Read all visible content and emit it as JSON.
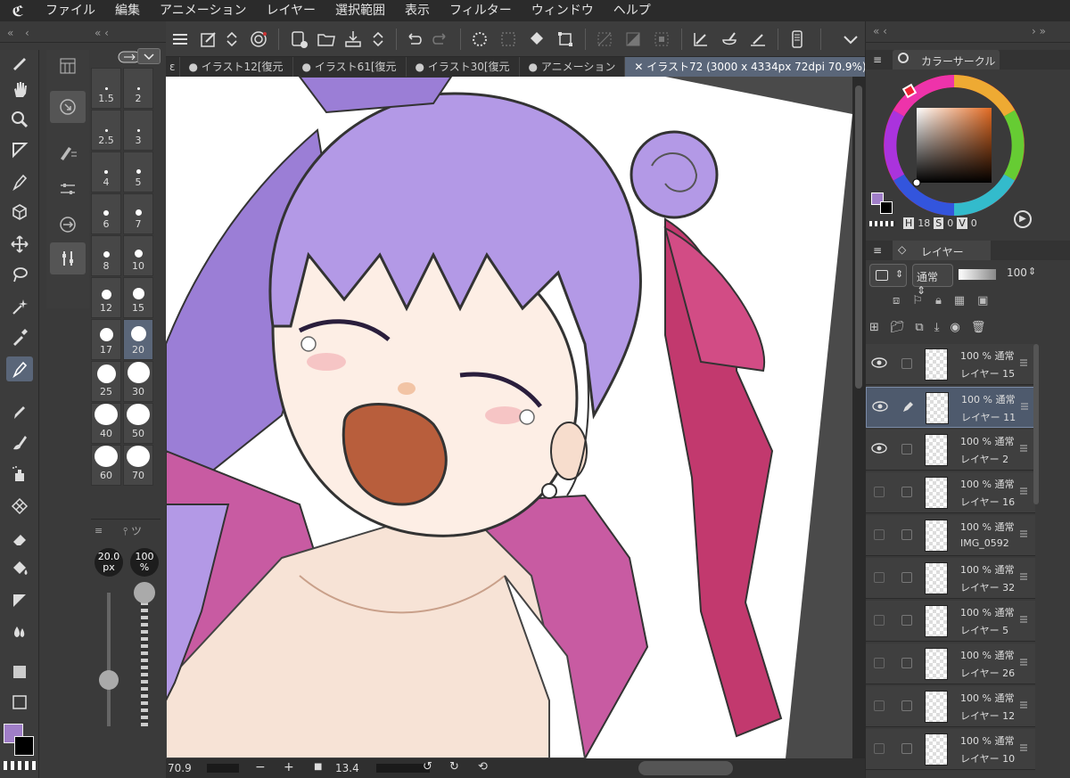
{
  "menu": {
    "items": [
      "ファイル",
      "編集",
      "アニメーション",
      "レイヤー",
      "選択範囲",
      "表示",
      "フィルター",
      "ウィンドウ",
      "ヘルプ"
    ]
  },
  "tabs": [
    {
      "label": "イラスト12[復元"
    },
    {
      "label": "イラスト61[復元"
    },
    {
      "label": "イラスト30[復元"
    },
    {
      "label": "アニメーション"
    },
    {
      "label": "イラスト72 (3000 x 4334px 72dpi 70.9%)",
      "active": true
    }
  ],
  "brush_sizes": [
    "1.5",
    "2",
    "2.5",
    "3",
    "4",
    "5",
    "6",
    "7",
    "8",
    "10",
    "12",
    "15",
    "17",
    "20",
    "25",
    "30",
    "40",
    "50",
    "60",
    "70"
  ],
  "brush_selected": "20",
  "slider_panel": {
    "tab_label": "ツ",
    "size_value": "20.0",
    "size_unit": "px",
    "opacity_value": "100",
    "opacity_unit": "%",
    "size_level": 0.35,
    "opacity_level": 1.0
  },
  "status": {
    "zoom": "70.9",
    "angle": "13.4"
  },
  "color_panel": {
    "title": "カラーサークル",
    "h_label": "H",
    "h_value": "18",
    "s_label": "S",
    "s_value": "0",
    "v_label": "V",
    "v_value": "0"
  },
  "layer_panel": {
    "title": "レイヤー",
    "blend_mode": "通常",
    "opacity": "100",
    "layers": [
      {
        "pct": "100 %  通常",
        "name": "レイヤー 15",
        "visible": true,
        "selected": false
      },
      {
        "pct": "100 %  通常",
        "name": "レイヤー 11",
        "visible": true,
        "selected": true
      },
      {
        "pct": "100 %  通常",
        "name": "レイヤー 2",
        "visible": true,
        "selected": false
      },
      {
        "pct": "100 %  通常",
        "name": "レイヤー 16",
        "visible": false,
        "selected": false
      },
      {
        "pct": "100 %  通常",
        "name": "IMG_0592",
        "visible": false,
        "selected": false
      },
      {
        "pct": "100 %  通常",
        "name": "レイヤー 32",
        "visible": false,
        "selected": false
      },
      {
        "pct": "100 %  通常",
        "name": "レイヤー 5",
        "visible": false,
        "selected": false
      },
      {
        "pct": "100 %  通常",
        "name": "レイヤー 26",
        "visible": false,
        "selected": false
      },
      {
        "pct": "100 %  通常",
        "name": "レイヤー 12",
        "visible": false,
        "selected": false
      },
      {
        "pct": "100 %  通常",
        "name": "レイヤー 10",
        "visible": false,
        "selected": false
      }
    ]
  },
  "colors": {
    "main_color": "#a07ec8",
    "sub_color": "#000000",
    "accent": "#5a6679",
    "hair": "#b399e6",
    "ribbon": "#c2396e"
  }
}
